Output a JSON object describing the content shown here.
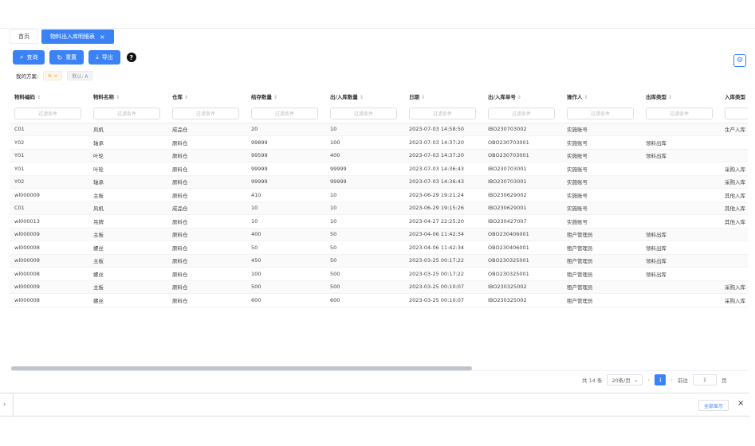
{
  "tabs": [
    {
      "label": "首页"
    },
    {
      "label": "物料出入库明细表",
      "close": "×"
    }
  ],
  "toolbar": {
    "query_label": "查询",
    "reset_label": "重置",
    "export_label": "导出",
    "help_glyph": "?"
  },
  "scheme": {
    "label": "我的方案:",
    "chip1": "A",
    "chip1_close": "×",
    "chip2": "默认: A"
  },
  "table": {
    "columns": [
      "物料编码",
      "物料名称",
      "仓库",
      "结存数量",
      "出/入库数量",
      "日期",
      "出/入库单号",
      "操作人",
      "出库类型",
      "入库类型"
    ],
    "filter_placeholder": "过滤条件",
    "rows": [
      [
        "C01",
        "风机",
        "成品仓",
        "20",
        "10",
        "2023-07-03 14:58:50",
        "IBO230703002",
        "实施账号",
        "",
        "生产入库"
      ],
      [
        "Y02",
        "轴承",
        "原料仓",
        "99899",
        "100",
        "2023-07-03 14:37:20",
        "OBO230703001",
        "实施账号",
        "领料出库",
        ""
      ],
      [
        "Y01",
        "叶轮",
        "原料仓",
        "99599",
        "400",
        "2023-07-03 14:37:20",
        "OBO230703001",
        "实施账号",
        "领料出库",
        ""
      ],
      [
        "Y01",
        "叶轮",
        "原料仓",
        "99999",
        "99999",
        "2023-07-03 14:36:43",
        "IBO230703001",
        "实施账号",
        "",
        "采购入库"
      ],
      [
        "Y02",
        "轴承",
        "原料仓",
        "99999",
        "99999",
        "2023-07-03 14:36:43",
        "IBO230703001",
        "实施账号",
        "",
        "采购入库"
      ],
      [
        "wl000009",
        "主板",
        "原料仓",
        "410",
        "10",
        "2023-06-29 19:21:24",
        "IBO230629002",
        "实施账号",
        "",
        "其他入库"
      ],
      [
        "C01",
        "风机",
        "成品仓",
        "10",
        "10",
        "2023-06-29 19:15:26",
        "IBO230629001",
        "实施账号",
        "",
        "其他入库"
      ],
      [
        "wl000013",
        "吊牌",
        "原料仓",
        "10",
        "10",
        "2023-04-27 22:25:20",
        "IBO230427007",
        "实施账号",
        "",
        "其他入库"
      ],
      [
        "wl000009",
        "主板",
        "原料仓",
        "400",
        "50",
        "2023-04-06 11:42:34",
        "OBO230406001",
        "租户管理员",
        "领料出库",
        ""
      ],
      [
        "wl000008",
        "螺丝",
        "原料仓",
        "50",
        "50",
        "2023-04-06 11:42:34",
        "OBO230406001",
        "租户管理员",
        "领料出库",
        ""
      ],
      [
        "wl000009",
        "主板",
        "原料仓",
        "450",
        "50",
        "2023-03-25 00:17:22",
        "OBO230325001",
        "租户管理员",
        "领料出库",
        ""
      ],
      [
        "wl000008",
        "螺丝",
        "原料仓",
        "100",
        "500",
        "2023-03-25 00:17:22",
        "OBO230325001",
        "租户管理员",
        "领料出库",
        ""
      ],
      [
        "wl000009",
        "主板",
        "原料仓",
        "500",
        "500",
        "2023-03-25 00:10:07",
        "IBO230325002",
        "租户管理员",
        "",
        "采购入库"
      ],
      [
        "wl000008",
        "螺丝",
        "原料仓",
        "600",
        "600",
        "2023-03-25 00:10:07",
        "IBO230325002",
        "租户管理员",
        "",
        "采购入库"
      ]
    ]
  },
  "pagination": {
    "total": "共 14 条",
    "page_size": "20条/页",
    "current_page": "1",
    "goto_label": "前往",
    "goto_value": "1",
    "page_suffix": "页"
  },
  "bottom": {
    "show_all": "全部显示",
    "close": "×"
  },
  "colors": {
    "accent": "#3b82f6"
  }
}
